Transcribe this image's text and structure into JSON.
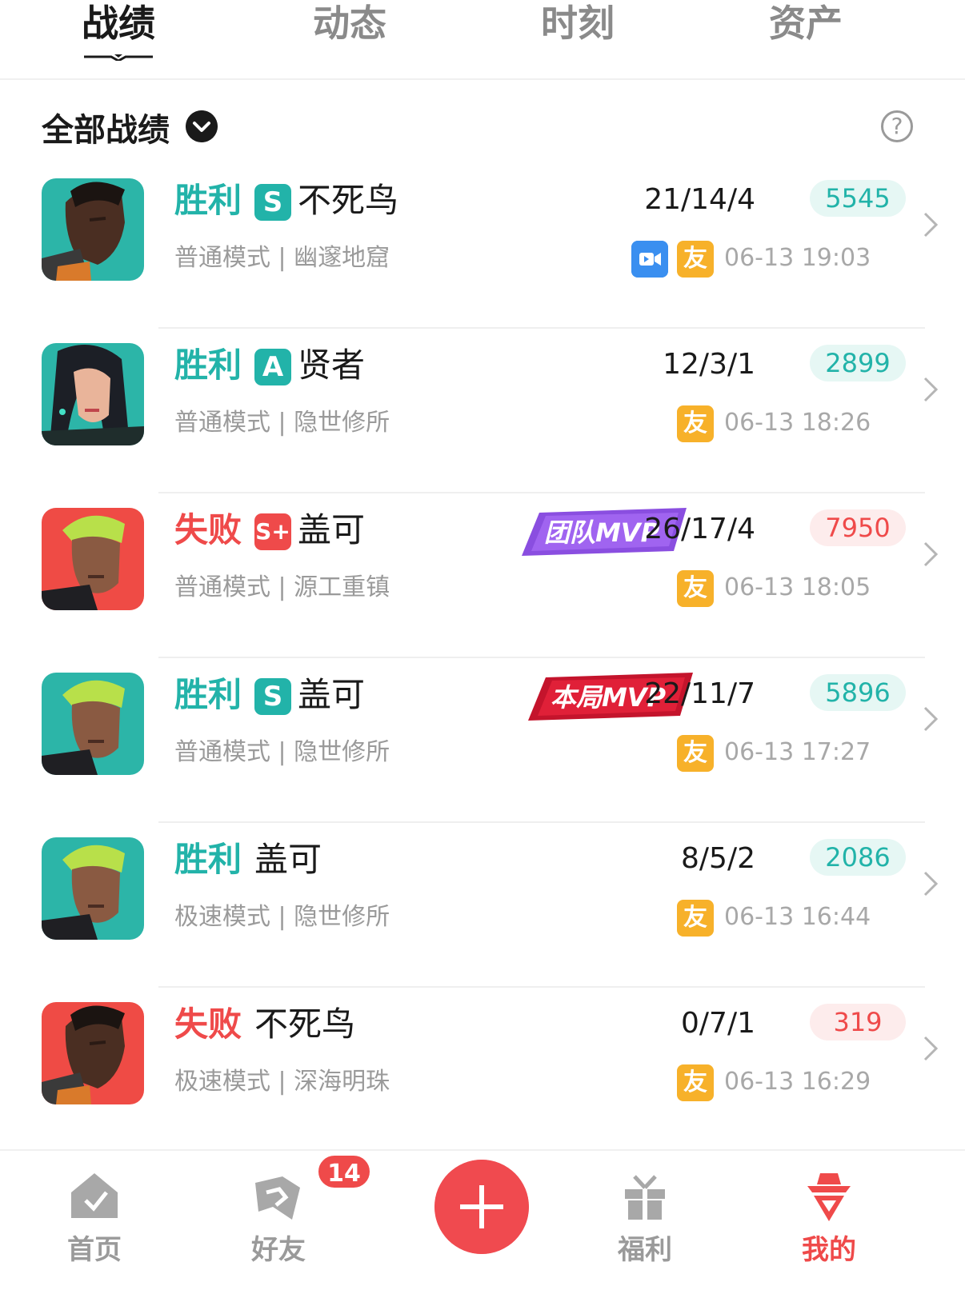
{
  "tabs": [
    {
      "label": "战绩",
      "active": true
    },
    {
      "label": "动态",
      "active": false
    },
    {
      "label": "时刻",
      "active": false
    },
    {
      "label": "资产",
      "active": false
    }
  ],
  "filter": {
    "title": "全部战绩",
    "help_icon": "?"
  },
  "records": [
    {
      "result": "胜利",
      "grade": "S",
      "hero": "不死鸟",
      "mode": "普通模式 | 幽邃地窟",
      "kda": "21/14/4",
      "score": "5545",
      "time": "06-13 19:03",
      "friend_badge": "友",
      "has_video": true,
      "mvp": null
    },
    {
      "result": "胜利",
      "grade": "A",
      "hero": "贤者",
      "mode": "普通模式 | 隐世修所",
      "kda": "12/3/1",
      "score": "2899",
      "time": "06-13 18:26",
      "friend_badge": "友",
      "has_video": false,
      "mvp": null
    },
    {
      "result": "失败",
      "grade": "S+",
      "hero": "盖可",
      "mode": "普通模式 | 源工重镇",
      "kda": "26/17/4",
      "score": "7950",
      "time": "06-13 18:05",
      "friend_badge": "友",
      "has_video": false,
      "mvp": "团队MVP"
    },
    {
      "result": "胜利",
      "grade": "S",
      "hero": "盖可",
      "mode": "普通模式 | 隐世修所",
      "kda": "22/11/7",
      "score": "5896",
      "time": "06-13 17:27",
      "friend_badge": "友",
      "has_video": false,
      "mvp": "本局MVP"
    },
    {
      "result": "胜利",
      "grade": "",
      "hero": "盖可",
      "mode": "极速模式 | 隐世修所",
      "kda": "8/5/2",
      "score": "2086",
      "time": "06-13 16:44",
      "friend_badge": "友",
      "has_video": false,
      "mvp": null
    },
    {
      "result": "失败",
      "grade": "",
      "hero": "不死鸟",
      "mode": "极速模式 | 深海明珠",
      "kda": "0/7/1",
      "score": "319",
      "time": "06-13 16:29",
      "friend_badge": "友",
      "has_video": false,
      "mvp": null
    }
  ],
  "nav": [
    {
      "label": "首页",
      "icon": "home-icon",
      "active": false
    },
    {
      "label": "好友",
      "icon": "friends-icon",
      "active": false,
      "badge": "14"
    },
    {
      "label": "",
      "icon": "add-icon",
      "active": false
    },
    {
      "label": "福利",
      "icon": "gift-icon",
      "active": false
    },
    {
      "label": "我的",
      "icon": "profile-icon",
      "active": true
    }
  ],
  "colors": {
    "win": "#22b3a9",
    "lose": "#ef4a4a",
    "friend_badge": "#f7b12a",
    "video_badge": "#3a8ff0",
    "accent": "#f04a4f"
  }
}
